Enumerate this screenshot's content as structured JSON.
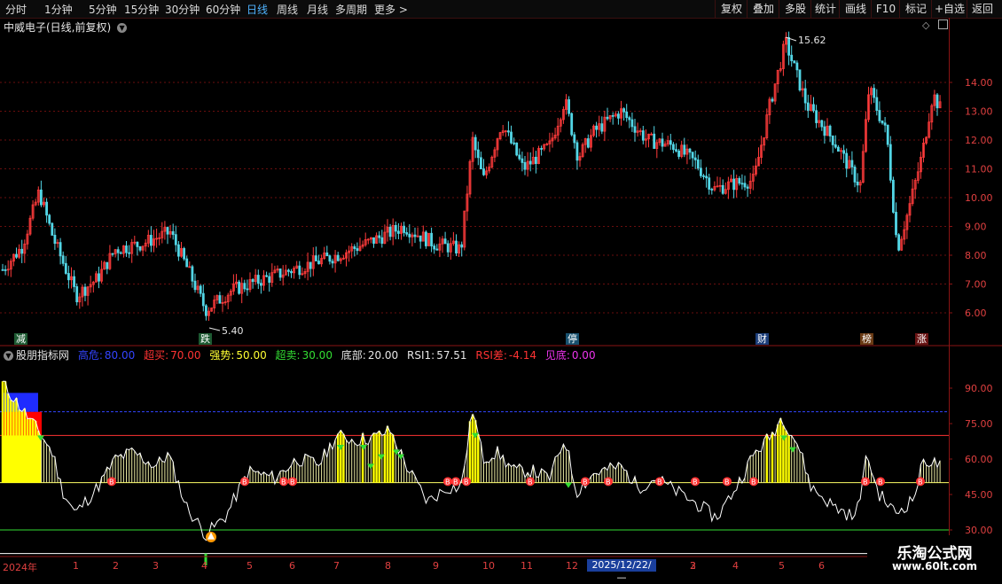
{
  "toolbar": {
    "periods": [
      "分时",
      "1分钟",
      "5分钟",
      "15分钟",
      "30分钟",
      "60分钟",
      "日线",
      "周线",
      "月线",
      "多周期",
      "更多 >"
    ],
    "active": "日线",
    "right_buttons": [
      "复权",
      "叠加",
      "多股",
      "统计",
      "画线",
      "F10",
      "标记",
      "+自选",
      "返回"
    ]
  },
  "stock": {
    "title": "中威电子(日线,前复权)"
  },
  "price_axis": {
    "labels": [
      "14.00",
      "13.00",
      "12.00",
      "11.00",
      "10.00",
      "9.00",
      "8.00",
      "7.00",
      "6.00"
    ]
  },
  "annotations": {
    "high": "15.62",
    "low": "5.40"
  },
  "event_tags": [
    {
      "text": "减",
      "color": "#2a8a4a"
    },
    {
      "text": "跌",
      "color": "#2a8a4a"
    },
    {
      "text": "停",
      "color": "#1f7aa8"
    },
    {
      "text": "财",
      "color": "#2a5fb8"
    },
    {
      "text": "榜",
      "color": "#a05a20"
    },
    {
      "text": "涨",
      "color": "#a02020"
    }
  ],
  "indicator": {
    "name": "股朋指标网",
    "params": [
      {
        "label": "高危:",
        "value": "80.00",
        "color": "#3344ff"
      },
      {
        "label": "超买:",
        "value": "70.00",
        "color": "#ff3333"
      },
      {
        "label": "强势:",
        "value": "50.00",
        "color": "#ffff33"
      },
      {
        "label": "超卖:",
        "value": "30.00",
        "color": "#33dd33"
      },
      {
        "label": "底部:",
        "value": "20.00",
        "color": "#e6e6e6"
      },
      {
        "label": "RSI1:",
        "value": "57.51",
        "color": "#e6e6e6"
      },
      {
        "label": "RSI差:",
        "value": "-4.14",
        "color": "#ff3333"
      },
      {
        "label": "见底:",
        "value": "0.00",
        "color": "#ee33ee"
      }
    ],
    "axis_labels": [
      "90.00",
      "75.00",
      "60.00",
      "45.00",
      "30.00"
    ]
  },
  "time_axis": {
    "year": "2024年",
    "months": [
      "1",
      "2",
      "3",
      "4",
      "5",
      "6",
      "7",
      "8",
      "9",
      "10",
      "11",
      "12",
      "2",
      "3",
      "4",
      "5",
      "6"
    ],
    "date_box": "2025/12/22/—"
  },
  "watermark": {
    "title": "乐淘公式网",
    "url": "www.60lt.com"
  },
  "colors": {
    "up": "#ff3b3b",
    "down": "#53d6e6",
    "grid": "#7a1010"
  }
}
